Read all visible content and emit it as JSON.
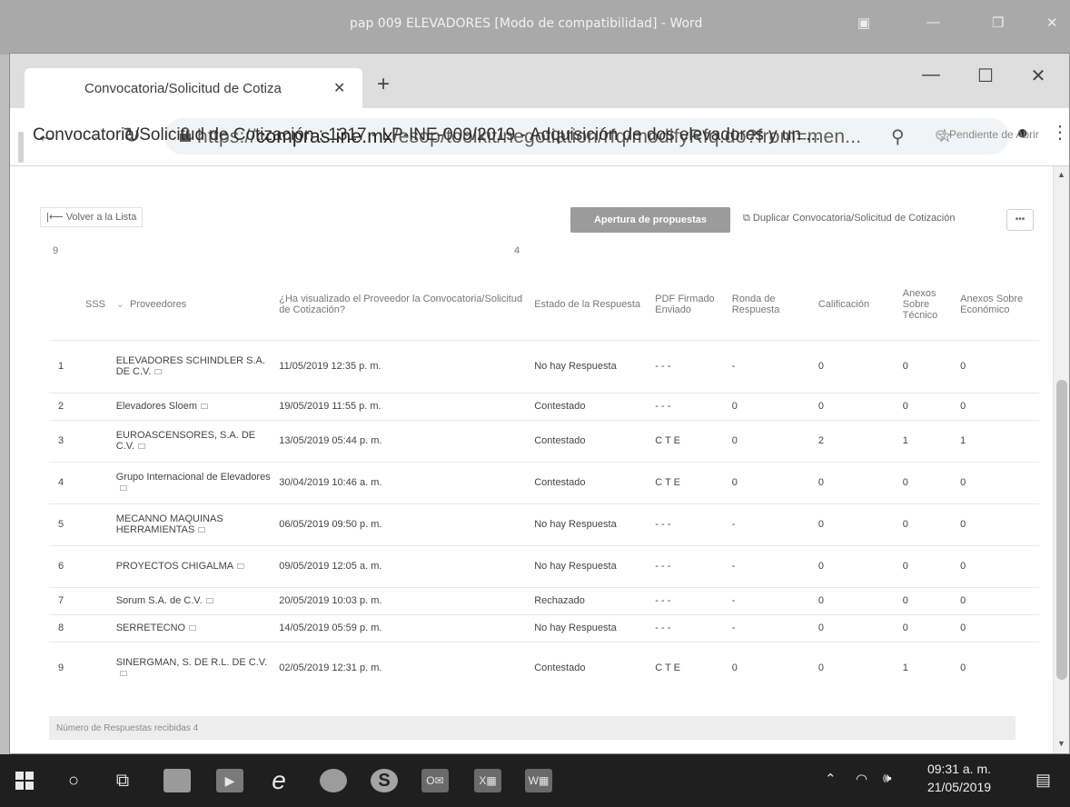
{
  "word_window": {
    "title": "pap 009 ELEVADORES [Modo de compatibilidad] - Word"
  },
  "browser": {
    "tab_title": "Convocatoria/Solicitud de Cotiza",
    "url_prefix": "https://",
    "url_host": "compras.ine.mx",
    "url_path": "/esop/toolkit/negotiation/rfq/modifyRfq.do?from=men..."
  },
  "page": {
    "title": "Convocatoria/Solicitud de Cotización : 1317 - LP-INE-009/2019 - Adquisición de dos elevadores y un ...",
    "status": "Pendiente de Abrir",
    "back_label": "Volver a la Lista",
    "open_button_label": "Apertura de propuestas",
    "duplicate_label": "Duplicar Convocatoria/Solicitud de Cotización",
    "more_label": "•••",
    "count_left": "9",
    "count_mid": "4",
    "footer_text": "Número de Respuestas recibidas 4"
  },
  "table": {
    "headers": {
      "sss": "SSS",
      "proveedores": "Proveedores",
      "visualizado": "¿Ha visualizado el Proveedor la Convocatoria/Solicitud de Cotización?",
      "estado": "Estado de la Respuesta",
      "pdf": "PDF Firmado Enviado",
      "ronda": "Ronda de Respuesta",
      "calificacion": "Calificación",
      "anexos_tecnico": "Anexos Sobre Técnico",
      "anexos_economico": "Anexos Sobre Económico"
    },
    "rows": [
      {
        "n": "1",
        "proveedor": "ELEVADORES SCHINDLER S.A. DE C.V.",
        "fecha": "11/05/2019 12:35 p. m.",
        "estado": "No hay Respuesta",
        "pdf": "- - -",
        "ronda": "-",
        "calificacion": "0",
        "tecnico": "0",
        "economico": "0"
      },
      {
        "n": "2",
        "proveedor": "Elevadores Sloem",
        "fecha": "19/05/2019 11:55 p. m.",
        "estado": "Contestado",
        "pdf": "- - -",
        "ronda": "0",
        "calificacion": "0",
        "tecnico": "0",
        "economico": "0"
      },
      {
        "n": "3",
        "proveedor": "EUROASCENSORES, S.A. DE C.V.",
        "fecha": "13/05/2019 05:44 p. m.",
        "estado": "Contestado",
        "pdf": "C T E",
        "ronda": "0",
        "calificacion": "2",
        "tecnico": "1",
        "economico": "1"
      },
      {
        "n": "4",
        "proveedor": "Grupo Internacional de Elevadores",
        "fecha": "30/04/2019 10:46 a. m.",
        "estado": "Contestado",
        "pdf": "C T E",
        "ronda": "0",
        "calificacion": "0",
        "tecnico": "0",
        "economico": "0"
      },
      {
        "n": "5",
        "proveedor": "MECANNO MAQUINAS HERRAMIENTAS",
        "fecha": "06/05/2019 09:50 p. m.",
        "estado": "No hay Respuesta",
        "pdf": "- - -",
        "ronda": "-",
        "calificacion": "0",
        "tecnico": "0",
        "economico": "0"
      },
      {
        "n": "6",
        "proveedor": "PROYECTOS CHIGALMA",
        "fecha": "09/05/2019 12:05 a. m.",
        "estado": "No hay Respuesta",
        "pdf": "- - -",
        "ronda": "-",
        "calificacion": "0",
        "tecnico": "0",
        "economico": "0"
      },
      {
        "n": "7",
        "proveedor": "Sorum S.A. de C.V.",
        "fecha": "20/05/2019 10:03 p. m.",
        "estado": "Rechazado",
        "pdf": "- - -",
        "ronda": "-",
        "calificacion": "0",
        "tecnico": "0",
        "economico": "0"
      },
      {
        "n": "8",
        "proveedor": "SERRETECNO",
        "fecha": "14/05/2019 05:59 p. m.",
        "estado": "No hay Respuesta",
        "pdf": "- - -",
        "ronda": "-",
        "calificacion": "0",
        "tecnico": "0",
        "economico": "0"
      },
      {
        "n": "9",
        "proveedor": "SINERGMAN, S. DE R.L. DE C.V.",
        "fecha": "02/05/2019 12:31 p. m.",
        "estado": "Contestado",
        "pdf": "C T E",
        "ronda": "0",
        "calificacion": "0",
        "tecnico": "1",
        "economico": "0"
      }
    ]
  },
  "taskbar": {
    "time": "09:31 a. m.",
    "date": "21/05/2019",
    "icons": [
      "windows-start-icon",
      "cortana-search-icon",
      "task-view-icon",
      "file-explorer-icon",
      "media-player-icon",
      "internet-explorer-icon",
      "chrome-icon",
      "skype-icon",
      "outlook-icon",
      "excel-icon",
      "word-icon"
    ]
  }
}
